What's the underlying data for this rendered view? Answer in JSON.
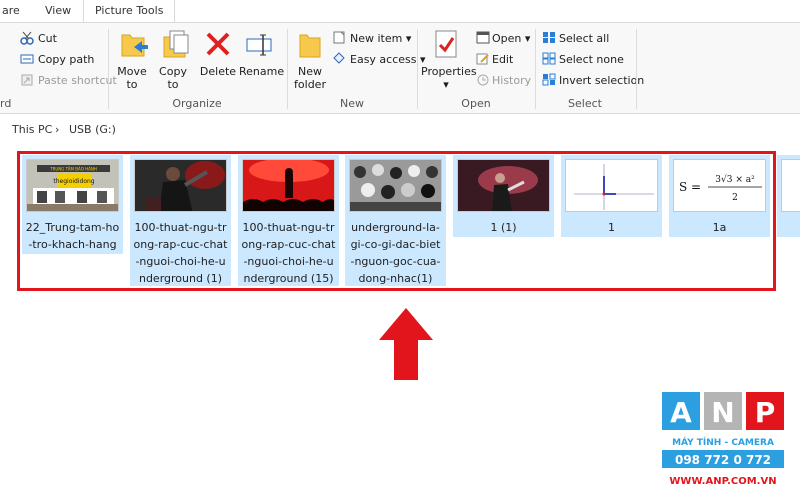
{
  "tabs": [
    "are",
    "View",
    "Picture Tools"
  ],
  "clipboard": {
    "cut": "Cut",
    "copy_path": "Copy path",
    "paste_shortcut": "Paste shortcut",
    "group": "rd"
  },
  "organize": {
    "move_to": "Move to",
    "copy_to": "Copy to",
    "delete": "Delete",
    "rename": "Rename",
    "group": "Organize"
  },
  "new": {
    "new_folder_1": "New",
    "new_folder_2": "folder",
    "new_item": "New item",
    "easy_access": "Easy access",
    "group": "New"
  },
  "open": {
    "properties": "Properties",
    "open": "Open",
    "edit": "Edit",
    "history": "History",
    "group": "Open"
  },
  "select": {
    "select_all": "Select all",
    "select_none": "Select none",
    "invert": "Invert selection",
    "group": "Select"
  },
  "breadcrumb": [
    "This PC",
    "USB (G:)"
  ],
  "separator": "›",
  "files": [
    {
      "lines": [
        "22_Trung-tam-ho",
        "-tro-khach-hang"
      ],
      "sign_top": "TRUNG TÂM BẢO HÀNH",
      "sign_brand": "thegioididong"
    },
    {
      "lines": [
        "100-thuat-ngu-tr",
        "ong-rap-cuc-chat",
        "-nguoi-choi-he-u",
        "nderground (1)"
      ]
    },
    {
      "lines": [
        "100-thuat-ngu-tr",
        "ong-rap-cuc-chat",
        "-nguoi-choi-he-u",
        "nderground (15)"
      ]
    },
    {
      "lines": [
        "underground-la-",
        "gi-co-gi-dac-biet",
        "-nguon-goc-cua-",
        "dong-nhac(1)"
      ]
    },
    {
      "lines": [
        "1 (1)"
      ]
    },
    {
      "lines": [
        "1"
      ]
    },
    {
      "lines": [
        "1a"
      ],
      "formula_lhs": "S =",
      "formula_num": "3√3 × a²",
      "formula_den": "2"
    }
  ],
  "logo": {
    "letters": [
      "A",
      "N",
      "P"
    ],
    "tagline": "MÁY TÍNH - CAMERA",
    "phone": "098 772 0 772",
    "website": "WWW.ANP.COM.VN",
    "colors": {
      "blue": "#2b9fe0",
      "red": "#e3151c",
      "grey": "#b4b4b4"
    }
  },
  "accent": {
    "selection": "#cce8ff",
    "highlight": "#e3151c"
  }
}
